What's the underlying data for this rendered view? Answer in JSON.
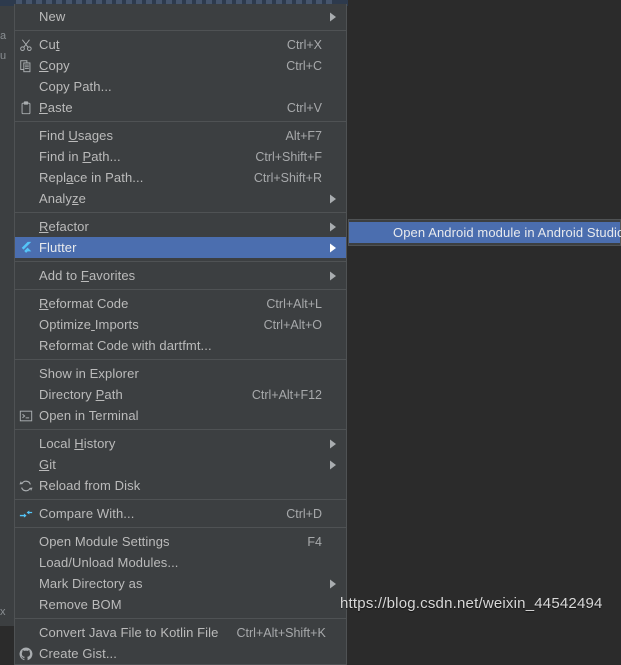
{
  "colors": {
    "menu_bg": "#3c3f41",
    "editor_bg": "#2b2b2b",
    "highlight": "#4b6eaf",
    "text": "#bbbbbb",
    "accel_text": "#a7a9ab",
    "separator": "#4f5254",
    "flutter_blue": "#54c5f8",
    "link_blue": "#589df6"
  },
  "context_menu": {
    "items": [
      {
        "type": "item",
        "label": "New",
        "accel": "",
        "icon": "",
        "submenu": true,
        "selected": false
      },
      {
        "type": "separator"
      },
      {
        "type": "item",
        "label": "Cut",
        "accel": "Ctrl+X",
        "icon": "scissors-icon",
        "submenu": false,
        "selected": false
      },
      {
        "type": "item",
        "label": "Copy",
        "accel": "Ctrl+C",
        "icon": "copy-icon",
        "submenu": false,
        "selected": false
      },
      {
        "type": "item",
        "label": "Copy Path...",
        "accel": "",
        "icon": "",
        "submenu": false,
        "selected": false
      },
      {
        "type": "item",
        "label": "Paste",
        "accel": "Ctrl+V",
        "icon": "clipboard-icon",
        "submenu": false,
        "selected": false
      },
      {
        "type": "separator"
      },
      {
        "type": "item",
        "label": "Find Usages",
        "accel": "Alt+F7",
        "icon": "",
        "submenu": false,
        "selected": false
      },
      {
        "type": "item",
        "label": "Find in Path...",
        "accel": "Ctrl+Shift+F",
        "icon": "",
        "submenu": false,
        "selected": false
      },
      {
        "type": "item",
        "label": "Replace in Path...",
        "accel": "Ctrl+Shift+R",
        "icon": "",
        "submenu": false,
        "selected": false
      },
      {
        "type": "item",
        "label": "Analyze",
        "accel": "",
        "icon": "",
        "submenu": true,
        "selected": false
      },
      {
        "type": "separator"
      },
      {
        "type": "item",
        "label": "Refactor",
        "accel": "",
        "icon": "",
        "submenu": true,
        "selected": false
      },
      {
        "type": "item",
        "label": "Flutter",
        "accel": "",
        "icon": "flutter-icon",
        "submenu": true,
        "selected": true
      },
      {
        "type": "separator"
      },
      {
        "type": "item",
        "label": "Add to Favorites",
        "accel": "",
        "icon": "",
        "submenu": true,
        "selected": false
      },
      {
        "type": "separator"
      },
      {
        "type": "item",
        "label": "Reformat Code",
        "accel": "Ctrl+Alt+L",
        "icon": "",
        "submenu": false,
        "selected": false
      },
      {
        "type": "item",
        "label": "Optimize Imports",
        "accel": "Ctrl+Alt+O",
        "icon": "",
        "submenu": false,
        "selected": false
      },
      {
        "type": "item",
        "label": "Reformat Code with dartfmt...",
        "accel": "",
        "icon": "",
        "submenu": false,
        "selected": false
      },
      {
        "type": "separator"
      },
      {
        "type": "item",
        "label": "Show in Explorer",
        "accel": "",
        "icon": "",
        "submenu": false,
        "selected": false
      },
      {
        "type": "item",
        "label": "Directory Path",
        "accel": "Ctrl+Alt+F12",
        "icon": "",
        "submenu": false,
        "selected": false
      },
      {
        "type": "item",
        "label": "Open in Terminal",
        "accel": "",
        "icon": "terminal-icon",
        "submenu": false,
        "selected": false
      },
      {
        "type": "separator"
      },
      {
        "type": "item",
        "label": "Local History",
        "accel": "",
        "icon": "",
        "submenu": true,
        "selected": false
      },
      {
        "type": "item",
        "label": "Git",
        "accel": "",
        "icon": "",
        "submenu": true,
        "selected": false
      },
      {
        "type": "item",
        "label": "Reload from Disk",
        "accel": "",
        "icon": "reload-icon",
        "submenu": false,
        "selected": false
      },
      {
        "type": "separator"
      },
      {
        "type": "item",
        "label": "Compare With...",
        "accel": "Ctrl+D",
        "icon": "compare-icon",
        "submenu": false,
        "selected": false
      },
      {
        "type": "separator"
      },
      {
        "type": "item",
        "label": "Open Module Settings",
        "accel": "F4",
        "icon": "",
        "submenu": false,
        "selected": false
      },
      {
        "type": "item",
        "label": "Load/Unload Modules...",
        "accel": "",
        "icon": "",
        "submenu": false,
        "selected": false
      },
      {
        "type": "item",
        "label": "Mark Directory as",
        "accel": "",
        "icon": "",
        "submenu": true,
        "selected": false
      },
      {
        "type": "item",
        "label": "Remove BOM",
        "accel": "",
        "icon": "",
        "submenu": false,
        "selected": false
      },
      {
        "type": "separator"
      },
      {
        "type": "item",
        "label": "Convert Java File to Kotlin File",
        "accel": "Ctrl+Alt+Shift+K",
        "icon": "",
        "submenu": false,
        "selected": false
      },
      {
        "type": "item",
        "label": "Create Gist...",
        "accel": "",
        "icon": "github-icon",
        "submenu": false,
        "selected": false
      }
    ]
  },
  "submenu": {
    "parent": "Flutter",
    "items": [
      {
        "label": "Open Android module in Android Studio",
        "selected": true
      }
    ]
  },
  "watermark": {
    "text": "https://blog.csdn.net/weixin_44542494"
  },
  "background_hints": {
    "ghost_left_1": "a",
    "ghost_left_2": "u",
    "ghost_left_3": "x"
  }
}
